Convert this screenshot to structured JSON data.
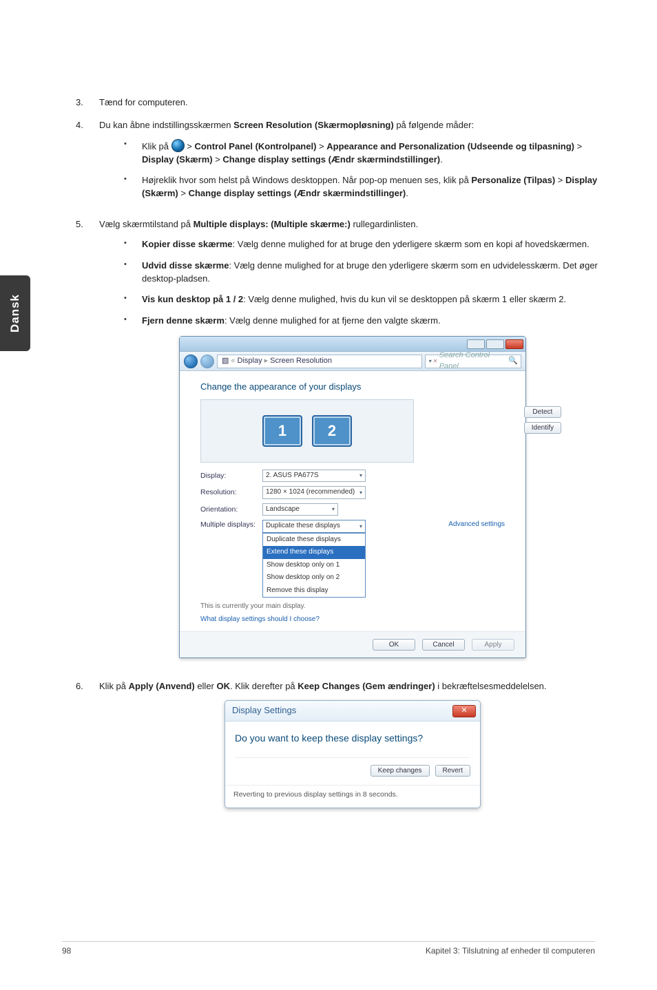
{
  "sideTab": "Dansk",
  "items": {
    "i3": {
      "num": "3.",
      "text": "Tænd for computeren."
    },
    "i4": {
      "num": "4.",
      "lead": "Du kan åbne indstillingsskærmen ",
      "bold": "Screen Resolution (Skærmopløsning)",
      "tail": " på følgende måder:",
      "a": {
        "p1": "Klik på ",
        "p2": " > ",
        "b1": "Control Panel (Kontrolpanel)",
        "p3": " > ",
        "b2": "Appearance and Personalization (Udseende og tilpasning)",
        "p4": " > ",
        "b3": "Display (Skærm)",
        "p5": " > ",
        "b4": "Change display settings (Ændr skærmindstillinger)",
        "p6": "."
      },
      "b": {
        "p1": "Højreklik hvor som helst på Windows desktoppen. Når pop-op menuen ses, klik på ",
        "b1": "Personalize (Tilpas)",
        "p2": " > ",
        "b2": "Display (Skærm)",
        "p3": " > ",
        "b3": "Change display settings (Ændr skærmindstillinger)",
        "p4": "."
      }
    },
    "i5": {
      "num": "5.",
      "p1": "Vælg skærmtilstand på ",
      "b1": "Multiple displays: (Multiple skærme:)",
      "p2": " rullegardinlisten.",
      "a": {
        "b": "Kopier disse skærme",
        "t": ": Vælg denne mulighed for at bruge den yderligere skærm som en kopi af hovedskærmen."
      },
      "b": {
        "b": "Udvid disse skærme",
        "t": ": Vælg denne mulighed for at bruge den yderligere skærm som en udvidelesskærm. Det øger desktop-pladsen."
      },
      "c": {
        "b": "Vis kun desktop på 1 / 2",
        "t": ": Vælg denne mulighed, hvis du kun vil se desktoppen på skærm 1 eller skærm 2."
      },
      "d": {
        "b": "Fjern denne skærm",
        "t": ": Vælg denne mulighed for at fjerne den valgte skærm."
      }
    },
    "i6": {
      "num": "6.",
      "p1": "Klik på ",
      "b1": "Apply (Anvend)",
      "p2": " eller ",
      "b2": "OK",
      "p3": ". Klik derefter på ",
      "b3": "Keep Changes (Gem ændringer)",
      "p4": " i bekræftelsesmeddelelsen."
    }
  },
  "win": {
    "crumb1": "Display",
    "crumb2": "Screen Resolution",
    "search": "Search Control Panel",
    "heading": "Change the appearance of your displays",
    "btnDetect": "Detect",
    "btnIdentify": "Identify",
    "mon1": "1",
    "mon2": "2",
    "rows": {
      "display": {
        "lbl": "Display:",
        "val": "2. ASUS PA677S"
      },
      "resolution": {
        "lbl": "Resolution:",
        "val": "1280 × 1024 (recommended)"
      },
      "orientation": {
        "lbl": "Orientation:",
        "val": "Landscape"
      },
      "multiple": {
        "lbl": "Multiple displays:"
      }
    },
    "drop": {
      "o1": "Duplicate these displays",
      "o2": "Extend these displays",
      "o3": "Show desktop only on 1",
      "o4": "Show desktop only on 2",
      "o5": "Remove this display"
    },
    "mainNote": "This is currently your main display.",
    "advLink": "Advanced settings",
    "helper2": "What display settings should I choose?",
    "ok": "OK",
    "cancel": "Cancel",
    "apply": "Apply"
  },
  "dlg": {
    "title": "Display Settings",
    "q": "Do you want to keep these display settings?",
    "keep": "Keep changes",
    "revert": "Revert",
    "note": "Reverting to previous display settings in 8 seconds."
  },
  "footer": {
    "page": "98",
    "chapter": "Kapitel 3: Tilslutning af enheder til computeren"
  }
}
